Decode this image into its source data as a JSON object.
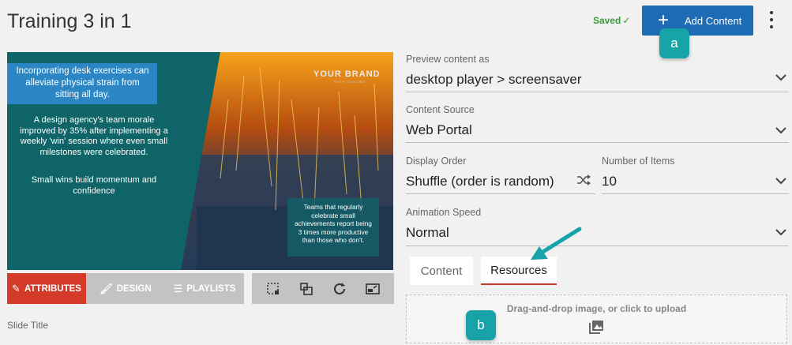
{
  "header": {
    "title": "Training 3 in 1",
    "saved_label": "Saved",
    "add_content_label": "Add Content"
  },
  "callouts": {
    "a": "a",
    "b": "b"
  },
  "preview": {
    "banner": "Incorporating desk exercises can alleviate physical strain from sitting all day.",
    "paragraph1": "A design agency's team morale improved by 35% after implementing a weekly 'win' session where even small milestones were celebrated.",
    "paragraph2": "Small wins build momentum and confidence",
    "brand": "YOUR BRAND",
    "brand_sub": "WITH TAGLINE",
    "box_text": "Teams that regularly celebrate small achievements report being 3 times more productive than those who don't."
  },
  "editor_tabs": {
    "attributes": "ATTRIBUTES",
    "design": "DESIGN",
    "playlists": "PLAYLISTS"
  },
  "slide_title_label": "Slide Title",
  "form": {
    "preview_as": {
      "label": "Preview content as",
      "value": "desktop player > screensaver"
    },
    "content_source": {
      "label": "Content Source",
      "value": "Web Portal"
    },
    "display_order": {
      "label": "Display Order",
      "value": "Shuffle (order is random)"
    },
    "number_of_items": {
      "label": "Number of Items",
      "value": "10"
    },
    "animation_speed": {
      "label": "Animation Speed",
      "value": "Normal"
    }
  },
  "content_tabs": {
    "content": "Content",
    "resources": "Resources"
  },
  "dropzone": {
    "text": "Drag-and-drop image, or click to upload"
  },
  "colors": {
    "accent": "#1e6cb5",
    "active_tab": "#d33a27",
    "callout": "#18a3a8",
    "saved": "#3c9a3c"
  },
  "icons": [
    "plus-icon",
    "check-icon",
    "kebab-icon",
    "pencil-icon",
    "brush-icon",
    "list-icon",
    "crop-icon",
    "layers-icon",
    "refresh-icon",
    "resize-icon",
    "shuffle-icon",
    "chevron-down-icon",
    "image-icon",
    "arrow-icon"
  ]
}
